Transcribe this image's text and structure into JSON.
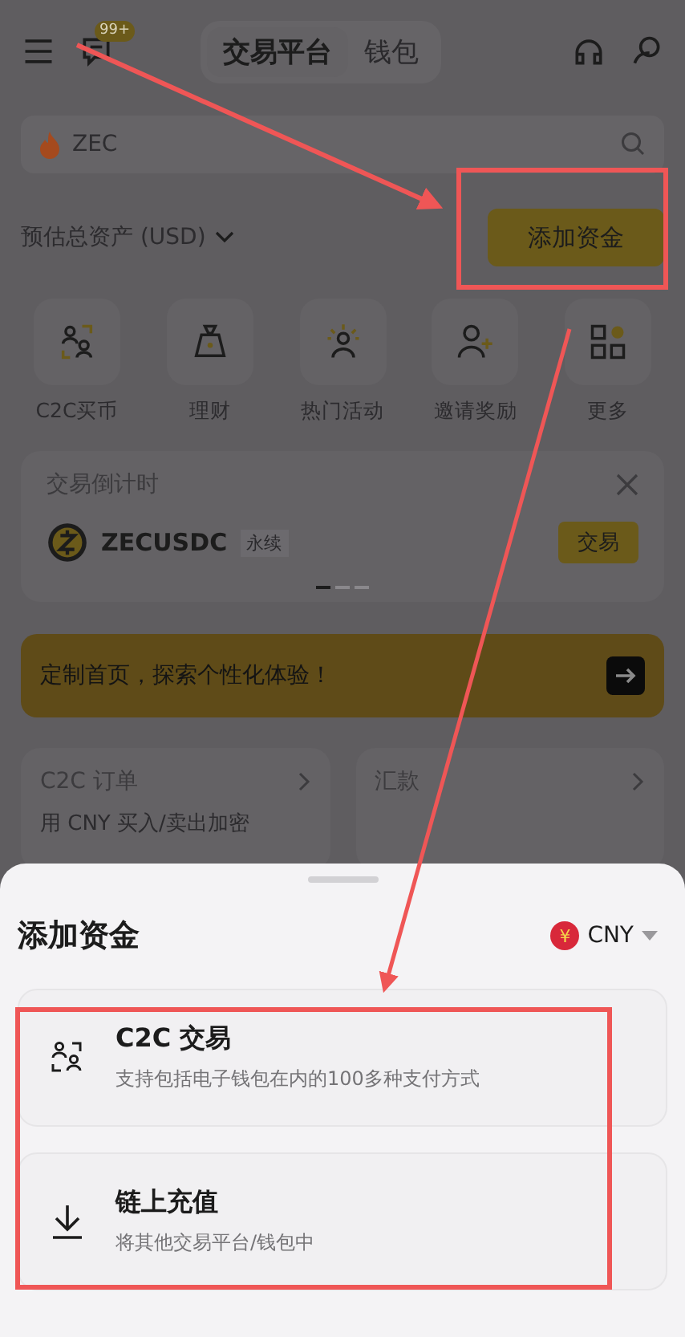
{
  "header": {
    "badge": "99+",
    "tabs": [
      {
        "label": "交易平台",
        "selected": true
      },
      {
        "label": "钱包",
        "selected": false
      }
    ]
  },
  "search": {
    "placeholder": "ZEC"
  },
  "assets": {
    "label": "预估总资产 (USD)",
    "button": "添加资金"
  },
  "shortcuts": [
    {
      "kind": "c2c",
      "label": "C2C买币"
    },
    {
      "kind": "earn",
      "label": "理财"
    },
    {
      "kind": "events",
      "label": "热门活动"
    },
    {
      "kind": "invite",
      "label": "邀请奖励"
    },
    {
      "kind": "more",
      "label": "更多"
    }
  ],
  "countdown": {
    "title": "交易倒计时",
    "symbol": "ZECUSDC",
    "tag": "永续",
    "button": "交易",
    "pages": [
      {
        "selected": true
      },
      {
        "selected": false
      },
      {
        "selected": false
      }
    ]
  },
  "banner": {
    "text": "定制首页，探索个性化体验！"
  },
  "cards": [
    {
      "title": "C2C 订单",
      "subtitle": "用 CNY 买入/卖出加密"
    },
    {
      "title": "汇款"
    }
  ],
  "sheet": {
    "title": "添加资金",
    "currency_symbol": "¥",
    "currency": "CNY",
    "options": [
      {
        "kind": "c2c",
        "title": "C2C 交易",
        "description": "支持包括电子钱包在内的100多种支付方式"
      },
      {
        "kind": "deposit",
        "title": "链上充值",
        "description": "将其他交易平台/钱包中"
      }
    ]
  }
}
